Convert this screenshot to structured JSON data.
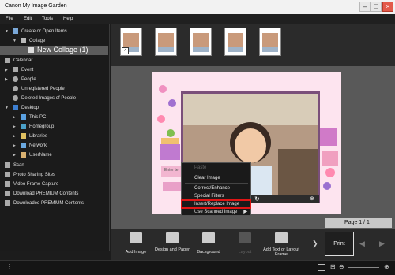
{
  "window": {
    "title": "Canon My Image Garden"
  },
  "menu": [
    "File",
    "Edit",
    "Tools",
    "Help"
  ],
  "sidebar": {
    "items": [
      {
        "label": "Create or Open Items",
        "icon": "create-items-icon"
      },
      {
        "label": "Collage",
        "icon": "collage-folder-icon"
      },
      {
        "label": "New Collage (1)",
        "icon": "collage-icon",
        "selected": true
      },
      {
        "label": "Calendar",
        "icon": "calendar-icon"
      },
      {
        "label": "Event",
        "icon": "event-icon"
      },
      {
        "label": "People",
        "icon": "people-icon"
      },
      {
        "label": "Unregistered People",
        "icon": "unregistered-people-icon"
      },
      {
        "label": "Deleted Images of People",
        "icon": "deleted-people-icon"
      },
      {
        "label": "Desktop",
        "icon": "desktop-icon"
      },
      {
        "label": "This PC",
        "icon": "pc-icon"
      },
      {
        "label": "Homegroup",
        "icon": "homegroup-icon"
      },
      {
        "label": "Libraries",
        "icon": "libraries-icon"
      },
      {
        "label": "Network",
        "icon": "network-icon"
      },
      {
        "label": "UserName",
        "icon": "user-icon"
      },
      {
        "label": "Scan",
        "icon": "scan-icon"
      },
      {
        "label": "Photo Sharing Sites",
        "icon": "photo-sharing-icon"
      },
      {
        "label": "Video Frame Capture",
        "icon": "video-capture-icon"
      },
      {
        "label": "Download PREMIUM Contents",
        "icon": "download-icon"
      },
      {
        "label": "Downloaded PREMIUM Contents",
        "icon": "downloaded-icon"
      }
    ]
  },
  "context_menu": {
    "items": [
      {
        "label": "Paste",
        "disabled": true
      },
      {
        "label": "Clear Image"
      },
      {
        "label": "Correct/Enhance"
      },
      {
        "label": "Special Filters"
      },
      {
        "label": "Insert/Replace Image",
        "highlighted": true
      },
      {
        "label": "Use Scanned Image",
        "submenu": "▶"
      }
    ]
  },
  "page_indicator": "Page 1 / 1",
  "toolbar": {
    "add_image": "Add Image",
    "design_paper": "Design and Paper",
    "background": "Background",
    "layout": "Layout",
    "add_text": "Add Text or Layout Frame",
    "print": "Print"
  },
  "colors": {
    "accent_highlight": "#e01515",
    "page_background": "#fde4ef",
    "frame": "#7a4f7a"
  }
}
